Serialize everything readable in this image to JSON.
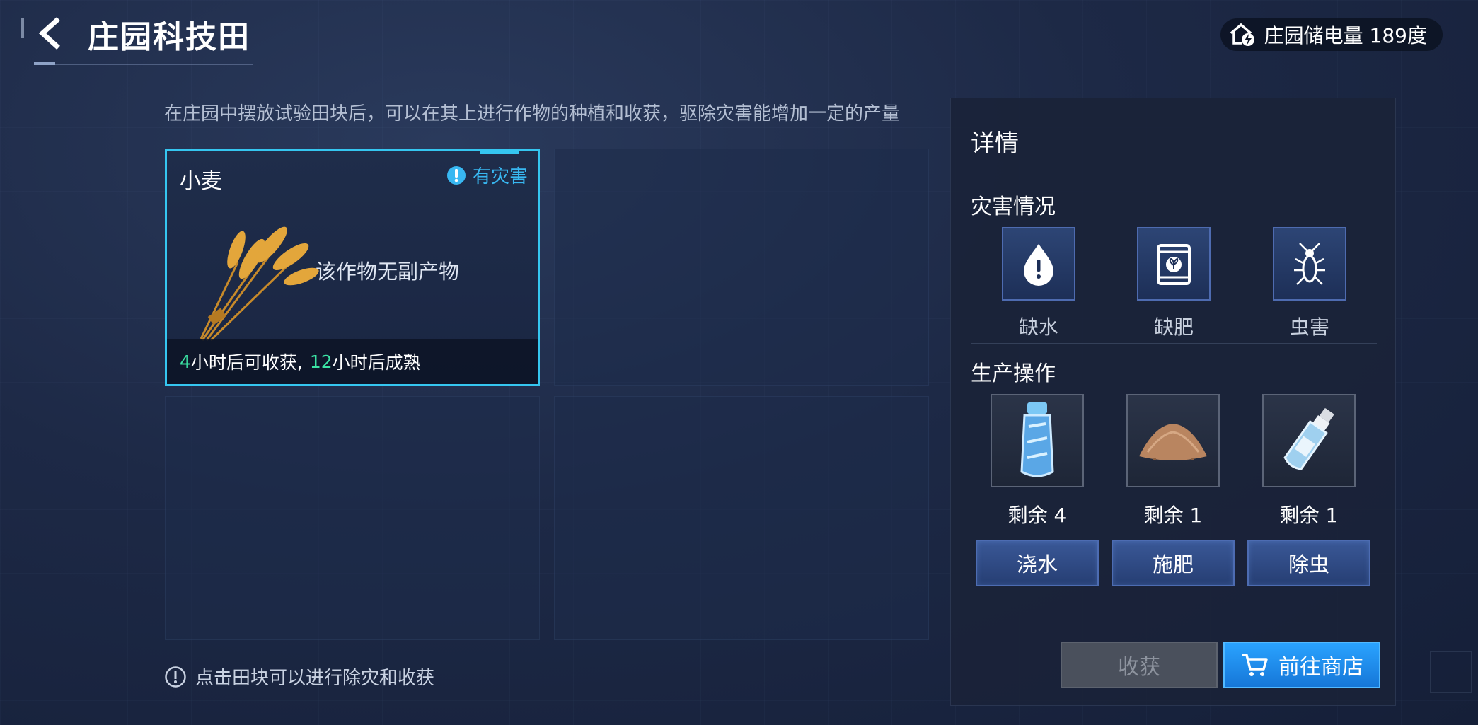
{
  "header": {
    "title": "庄园科技田",
    "energy_label": "庄园储电量 189度"
  },
  "description": "在庄园中摆放试验田块后，可以在其上进行作物的种植和收获，驱除灾害能增加一定的产量",
  "plot": {
    "crop_name": "小麦",
    "disaster_tag": "有灾害",
    "byproduct_text": "该作物无副产物",
    "harvest_hours": "4",
    "harvest_suffix": "小时后可收获,",
    "mature_hours": "12",
    "mature_suffix": "小时后成熟"
  },
  "hint": "点击田块可以进行除灾和收获",
  "details": {
    "title": "详情",
    "disaster_section": "灾害情况",
    "disasters": [
      {
        "label": "缺水",
        "icon": "water-drop-alert-icon"
      },
      {
        "label": "缺肥",
        "icon": "fertilizer-bag-icon"
      },
      {
        "label": "虫害",
        "icon": "insect-icon"
      }
    ],
    "operation_section": "生产操作",
    "operations": [
      {
        "remain": "剩余 4",
        "button": "浇水",
        "icon": "water-bottle-icon"
      },
      {
        "remain": "剩余 1",
        "button": "施肥",
        "icon": "fertilizer-pile-icon"
      },
      {
        "remain": "剩余 1",
        "button": "除虫",
        "icon": "pesticide-bottle-icon"
      }
    ],
    "harvest_button": "收获",
    "shop_button": "前往商店"
  },
  "colors": {
    "accent_cyan": "#35c6f0",
    "countdown_green": "#3be3a4",
    "shop_blue": "#1f8ff0"
  }
}
